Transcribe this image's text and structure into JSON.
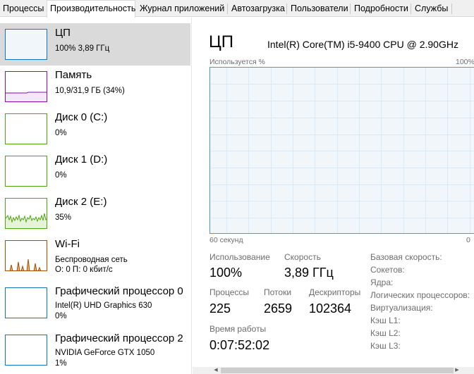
{
  "tabs": [
    {
      "label": "Процессы"
    },
    {
      "label": "Производительность"
    },
    {
      "label": "Журнал приложений"
    },
    {
      "label": "Автозагрузка"
    },
    {
      "label": "Пользователи"
    },
    {
      "label": "Подробности"
    },
    {
      "label": "Службы"
    }
  ],
  "active_tab": "Производительность",
  "sidebar": {
    "items": [
      {
        "title": "ЦП",
        "sub": "100% 3,89 ГГц",
        "color": "#1177bb"
      },
      {
        "title": "Память",
        "sub": "10,9/31,9 ГБ (34%)",
        "color": "#8b12ae"
      },
      {
        "title": "Диск 0 (C:)",
        "sub": "0%",
        "color": "#4da60c"
      },
      {
        "title": "Диск 1 (D:)",
        "sub": "0%",
        "color": "#4da60c"
      },
      {
        "title": "Диск 2 (E:)",
        "sub": "35%",
        "color": "#4da60c"
      },
      {
        "title": "Wi-Fi",
        "sub": "Беспроводная сеть",
        "sub2": "О: 0 П: 0 кбит/с",
        "color": "#a74f01"
      },
      {
        "title": "Графический процессор 0",
        "sub": "Intel(R) UHD Graphics 630",
        "sub2": "0%",
        "color": "#1177bb"
      },
      {
        "title": "Графический процессор 2",
        "sub": "NVIDIA GeForce GTX 1050",
        "sub2": "1%",
        "color": "#1177bb"
      }
    ]
  },
  "main": {
    "title": "ЦП",
    "cpu_model": "Intel(R) Core(TM) i5-9400 CPU @ 2.90GHz",
    "graph": {
      "ylabel": "Используется %",
      "ymax_label": "100%",
      "xlabel": "60 секунд",
      "xmin_label": "0",
      "utilization_percent": 100,
      "line_color": "#1177bb",
      "fill_color": "#f1f6fb"
    },
    "stats": {
      "usage_label": "Использование",
      "usage_value": "100%",
      "speed_label": "Скорость",
      "speed_value": "3,89 ГГц",
      "processes_label": "Процессы",
      "processes_value": "225",
      "threads_label": "Потоки",
      "threads_value": "2659",
      "handles_label": "Дескрипторы",
      "handles_value": "102364",
      "uptime_label": "Время работы",
      "uptime_value": "0:07:52:02"
    },
    "info": [
      {
        "label": "Базовая скорость:"
      },
      {
        "label": "Сокетов:"
      },
      {
        "label": "Ядра:"
      },
      {
        "label": "Логических процессоров:"
      },
      {
        "label": "Виртуализация:"
      },
      {
        "label": "Кэш L1:"
      },
      {
        "label": "Кэш L2:"
      },
      {
        "label": "Кэш L3:"
      }
    ]
  },
  "scrollbar": {
    "left_arrow_icon": "arrow-left-icon",
    "right_arrow_icon": "arrow-right-icon"
  }
}
